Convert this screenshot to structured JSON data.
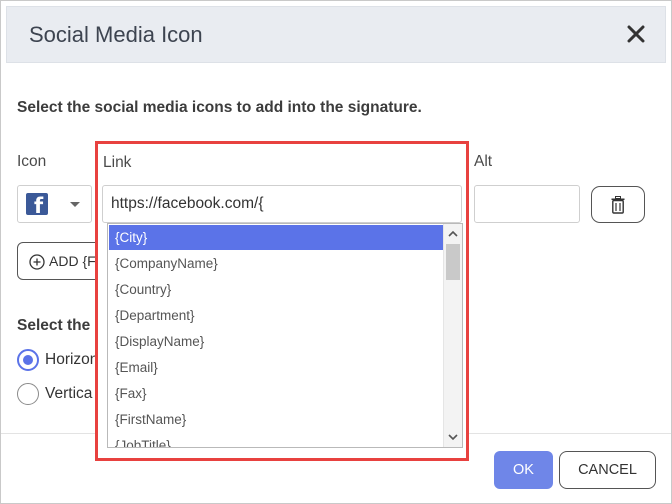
{
  "dialog": {
    "title": "Social Media Icon",
    "instructions": "Select the social media icons to add into the signature."
  },
  "columns": {
    "icon": "Icon",
    "link": "Link",
    "alt": "Alt"
  },
  "row": {
    "icon": "facebook-icon",
    "link_value": "https://facebook.com/{",
    "alt_value": ""
  },
  "add_button": {
    "label": "ADD {FI"
  },
  "layout": {
    "label": "Select the l",
    "options": [
      {
        "label": "Horizont",
        "checked": true
      },
      {
        "label": "Vertica",
        "checked": false
      }
    ]
  },
  "dropdown": {
    "options": [
      "{City}",
      "{CompanyName}",
      "{Country}",
      "{Department}",
      "{DisplayName}",
      "{Email}",
      "{Fax}",
      "{FirstName}",
      "{JobTitle}"
    ],
    "selected_index": 0
  },
  "footer": {
    "ok": "OK",
    "cancel": "CANCEL"
  },
  "colors": {
    "accent": "#5b73e8",
    "highlight": "#e8413f",
    "ok_bg": "#6f86e8",
    "facebook": "#3b5998"
  }
}
